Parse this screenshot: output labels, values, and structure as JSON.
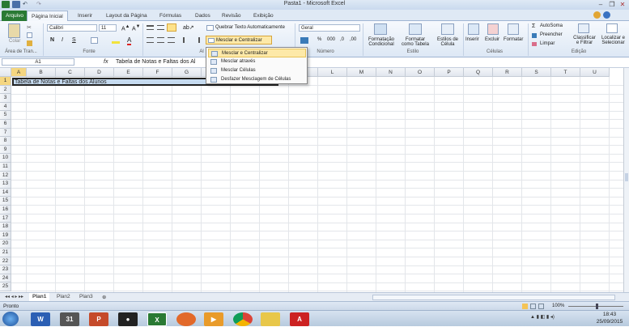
{
  "window": {
    "title": "Pasta1 - Microsoft Excel"
  },
  "tabs": [
    "Arquivo",
    "Página Inicial",
    "Inserir",
    "Layout da Página",
    "Fórmulas",
    "Dados",
    "Revisão",
    "Exibição"
  ],
  "ribbon": {
    "clipboard": {
      "paste": "Colar",
      "label": "Área de Tran..."
    },
    "font": {
      "name": "Calibri",
      "size": "11",
      "bold": "N",
      "italic": "I",
      "underline": "S",
      "label": "Fonte"
    },
    "alignment": {
      "wrap": "Quebrar Texto Automaticamente",
      "merge": "Mesclar e Centralizar",
      "label": "Al"
    },
    "number": {
      "format": "Geral",
      "label": "Número",
      "percent": "%",
      "thousands": "000"
    },
    "styles": {
      "conditional": "Formatação Condicional",
      "table": "Formatar como Tabela",
      "cell": "Estilos de Célula",
      "label": "Estilo"
    },
    "cells": {
      "insert": "Inserir",
      "delete": "Excluir",
      "format": "Formatar",
      "label": "Células"
    },
    "editing": {
      "autosum": "AutoSoma",
      "fill": "Preencher",
      "clear": "Limpar",
      "sort": "Classificar e Filtrar",
      "find": "Localizar e Selecionar",
      "label": "Edição"
    }
  },
  "formula_bar": {
    "cell_ref": "A1",
    "fx": "fx",
    "content": "Tabela de Notas e Faltas dos Al"
  },
  "merge_menu": [
    {
      "label": "Mesclar e Centralizar",
      "selected": true
    },
    {
      "label": "Mesclar através",
      "selected": false
    },
    {
      "label": "Mesclar Células",
      "selected": false
    },
    {
      "label": "Desfazer Mesclagem de Células",
      "selected": false
    }
  ],
  "grid": {
    "columns": [
      "A",
      "B",
      "C",
      "D",
      "E",
      "F",
      "G",
      "H",
      "I",
      "J",
      "K",
      "L",
      "M",
      "N",
      "O",
      "P",
      "Q",
      "R",
      "S",
      "T",
      "U"
    ],
    "rows": [
      "1",
      "2",
      "3",
      "4",
      "5",
      "6",
      "7",
      "8",
      "9",
      "10",
      "11",
      "12",
      "13",
      "14",
      "15",
      "16",
      "17",
      "18",
      "19",
      "20",
      "21",
      "22",
      "23",
      "24",
      "25"
    ],
    "a1_text": "Tabela de Notas e Faltas dos Alunos"
  },
  "sheets": [
    "Plan1",
    "Plan2",
    "Plan3"
  ],
  "status": {
    "text": "Pronto",
    "zoom": "100%"
  },
  "taskbar": {
    "time": "18:43",
    "date": "25/09/2015"
  },
  "colors": {
    "excel_green": "#2a7a34",
    "header_blue": "#dfe9f5",
    "selection": "#c6dbf0",
    "highlight": "#fde9a8"
  }
}
